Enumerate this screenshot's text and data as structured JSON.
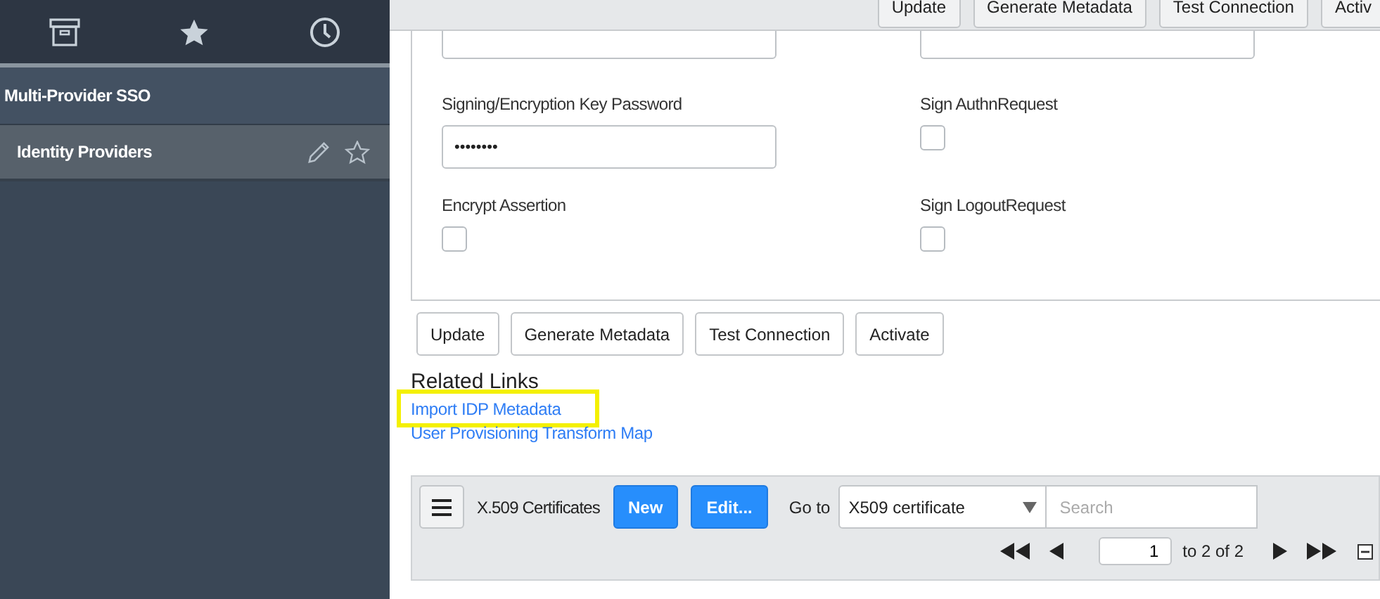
{
  "sidebar": {
    "section": "Multi-Provider SSO",
    "items": [
      {
        "label": "Identity Providers",
        "selected": true
      }
    ]
  },
  "header_buttons": [
    "Update",
    "Generate Metadata",
    "Test Connection",
    "Activ"
  ],
  "form": {
    "fields": [
      {
        "kind": "input"
      },
      {
        "kind": "input"
      },
      {
        "kind": "password",
        "label": "Signing/Encryption Key Password",
        "value": "••••••••"
      },
      {
        "kind": "checkbox",
        "label": "Sign AuthnRequest",
        "checked": false
      },
      {
        "kind": "checkbox",
        "label": "Encrypt Assertion",
        "checked": false
      },
      {
        "kind": "checkbox",
        "label": "Sign LogoutRequest",
        "checked": false
      }
    ]
  },
  "form_buttons": [
    "Update",
    "Generate Metadata",
    "Test Connection",
    "Activate"
  ],
  "related_links": {
    "title": "Related Links",
    "links": [
      {
        "label": "Import IDP Metadata",
        "highlighted": true
      },
      {
        "label": "User Provisioning Transform Map",
        "highlighted": false
      }
    ]
  },
  "related_list": {
    "title": "X.509 Certificates",
    "buttons": [
      "New",
      "Edit..."
    ],
    "goto_label": "Go to",
    "goto_field": "X509 certificate",
    "search": {
      "placeholder": "Search"
    },
    "pager": {
      "page": "1",
      "range": "to 2 of 2"
    }
  }
}
